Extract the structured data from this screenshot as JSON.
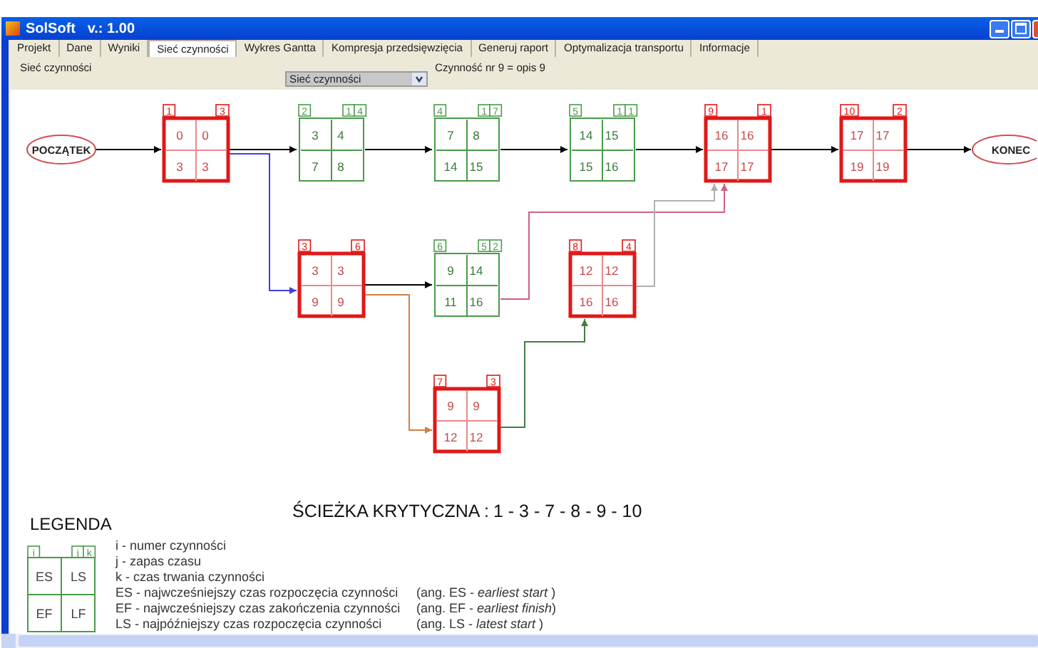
{
  "window": {
    "title": "SolSoft   v.: 1.00"
  },
  "tabs": [
    {
      "label": "Projekt",
      "selected": false
    },
    {
      "label": "Dane",
      "selected": false
    },
    {
      "label": "Wyniki",
      "selected": false
    },
    {
      "label": "Sieć czynności",
      "selected": true
    },
    {
      "label": "Wykres Gantta",
      "selected": false
    },
    {
      "label": "Kompresja przedsięwzięcia",
      "selected": false
    },
    {
      "label": "Generuj raport",
      "selected": false
    },
    {
      "label": "Optymalizacja transportu",
      "selected": false
    },
    {
      "label": "Informacje",
      "selected": false
    }
  ],
  "view_label": "Sieć czynności",
  "view_select": {
    "value": "Sieć czynności"
  },
  "activity_info": "Czynność nr 9 = opis 9",
  "network": {
    "start": "POCZĄTEK",
    "end": "KONEC",
    "nodes": [
      {
        "i": "1",
        "k": "3",
        "es": "0",
        "ls": "0",
        "ef": "3",
        "lf": "3",
        "critical": true
      },
      {
        "i": "2",
        "j": "1",
        "k": "4",
        "es": "3",
        "ls": "4",
        "ef": "7",
        "lf": "8",
        "critical": false
      },
      {
        "i": "4",
        "j": "1",
        "k": "7",
        "es": "7",
        "ls": "8",
        "ef": "14",
        "lf": "15",
        "critical": false
      },
      {
        "i": "5",
        "j": "1",
        "k": "1",
        "es": "14",
        "ls": "15",
        "ef": "15",
        "lf": "16",
        "critical": false
      },
      {
        "i": "9",
        "k": "1",
        "es": "16",
        "ls": "16",
        "ef": "17",
        "lf": "17",
        "critical": true
      },
      {
        "i": "10",
        "k": "2",
        "es": "17",
        "ls": "17",
        "ef": "19",
        "lf": "19",
        "critical": true
      },
      {
        "i": "3",
        "k": "6",
        "es": "3",
        "ls": "3",
        "ef": "9",
        "lf": "9",
        "critical": true
      },
      {
        "i": "6",
        "j": "5",
        "k": "2",
        "es": "9",
        "ls": "14",
        "ef": "11",
        "lf": "16",
        "critical": false
      },
      {
        "i": "8",
        "k": "4",
        "es": "12",
        "ls": "12",
        "ef": "16",
        "lf": "16",
        "critical": true
      },
      {
        "i": "7",
        "k": "3",
        "es": "9",
        "ls": "9",
        "ef": "12",
        "lf": "12",
        "critical": true
      }
    ],
    "edges": [
      {
        "color": "#000000"
      },
      {
        "color": "#000000"
      },
      {
        "color": "#000000"
      },
      {
        "color": "#000000"
      },
      {
        "color": "#000000"
      },
      {
        "color": "#000000"
      },
      {
        "color": "#000000"
      },
      {
        "color": "#4040e0"
      },
      {
        "color": "#000000"
      },
      {
        "color": "#d08040"
      },
      {
        "color": "#d06080"
      },
      {
        "color": "#b0b0b0"
      },
      {
        "color": "#408040"
      }
    ]
  },
  "critical_path": {
    "label": "ŚCIEŻKA KRYTYCZNA :",
    "value": "1 - 3 - 7 - 8 - 9 - 10"
  },
  "legend": {
    "title": "LEGENDA",
    "sample": {
      "i": "i",
      "j": "j",
      "k": "k",
      "es": "ES",
      "ls": "LS",
      "ef": "EF",
      "lf": "LF"
    },
    "lines": [
      {
        "text": "i - numer czynności"
      },
      {
        "text": "j - zapas czasu"
      },
      {
        "text": "k - czas trwania czynności"
      },
      {
        "text": "ES - najwcześniejszy czas rozpoczęcia czynności",
        "note": "(ang. ES - *earliest start* )"
      },
      {
        "text": "EF - najwcześniejszy czas zakończenia czynności",
        "note": "(ang. EF - *earliest finish*)"
      },
      {
        "text": "LS - najpóźniejszy czas rozpoczęcia czynności",
        "note": "(ang. LS - *latest start* )"
      }
    ]
  }
}
